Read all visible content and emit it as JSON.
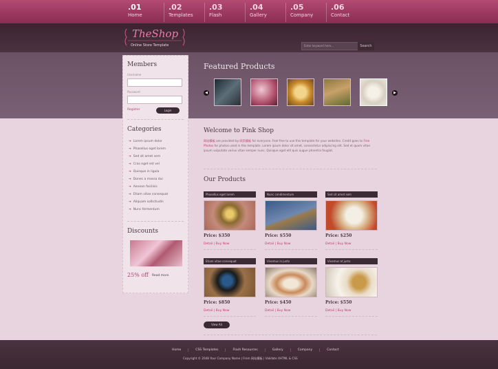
{
  "nav": [
    {
      "num": ".01",
      "label": "Home"
    },
    {
      "num": ".02",
      "label": "Templates"
    },
    {
      "num": ".03",
      "label": "Flash"
    },
    {
      "num": ".04",
      "label": "Gallery"
    },
    {
      "num": ".05",
      "label": "Company"
    },
    {
      "num": ".06",
      "label": "Contact"
    }
  ],
  "logo": {
    "title": "TheShop",
    "tagline": "Online Store Template"
  },
  "search": {
    "placeholder": "Enter keyword here...",
    "button": "Search"
  },
  "featured": {
    "title": "Featured Products"
  },
  "members": {
    "title": "Members",
    "username_label": "Username",
    "password_label": "Password",
    "register": "Register",
    "login": "Login"
  },
  "categories": {
    "title": "Categories",
    "items": [
      "Lorem ipsum dolor",
      "Phasellus eget lorem",
      "Sed sit amet sem",
      "Cras eget est vel",
      "Quisque in ligula",
      "Donec a massa dui",
      "Aenean facilisis",
      "Etiam vitae consequat",
      "Aliquam sollicitudin",
      "Nunc fermentum"
    ]
  },
  "discounts": {
    "title": "Discounts",
    "offer": "25% off",
    "more": "Read more"
  },
  "welcome": {
    "title": "Welcome to Pink Shop",
    "p1": "网站模板",
    "p2": " are provided by ",
    "p3": "网页模板",
    "p4": " for everyone. Feel free to use this template for your websites. Credit goes to ",
    "p5": "Free Photos",
    "p6": " for photos used in this template. Lorem ipsum dolor sit amet, consectetur adipiscing elit. Sed et quam vitae ipsum vulputate varius vitae semper nunc. Quisque eget elit quis augue pharetra feugiat."
  },
  "our_products": {
    "title": "Our Products",
    "items": [
      {
        "name": "Phasellus eget lorem",
        "price": "Price: $350",
        "links": "Detail | Buy Now"
      },
      {
        "name": "Nunc condimentum",
        "price": "Price: $550",
        "links": "Detail | Buy Now"
      },
      {
        "name": "Sed sit amet sem",
        "price": "Price: $250",
        "links": "Detail | Buy Now"
      },
      {
        "name": "Etiam vitae consequat",
        "price": "Price: $850",
        "links": "Detail | Buy Now"
      },
      {
        "name": "Vivamus in justo",
        "price": "Price: $450",
        "links": "Detail | Buy Now"
      },
      {
        "name": "Vivamus at justo",
        "price": "Price: $550",
        "links": "Detail | Buy Now"
      }
    ],
    "view_all": "View All"
  },
  "footer": {
    "links": [
      "Home",
      "CSS Templates",
      "Flash Resources",
      "Gallery",
      "Company",
      "Contact"
    ],
    "copyright": "Copyright © 2048 Your Company Name | From 网站模板 | Validate XHTML & CSS"
  }
}
